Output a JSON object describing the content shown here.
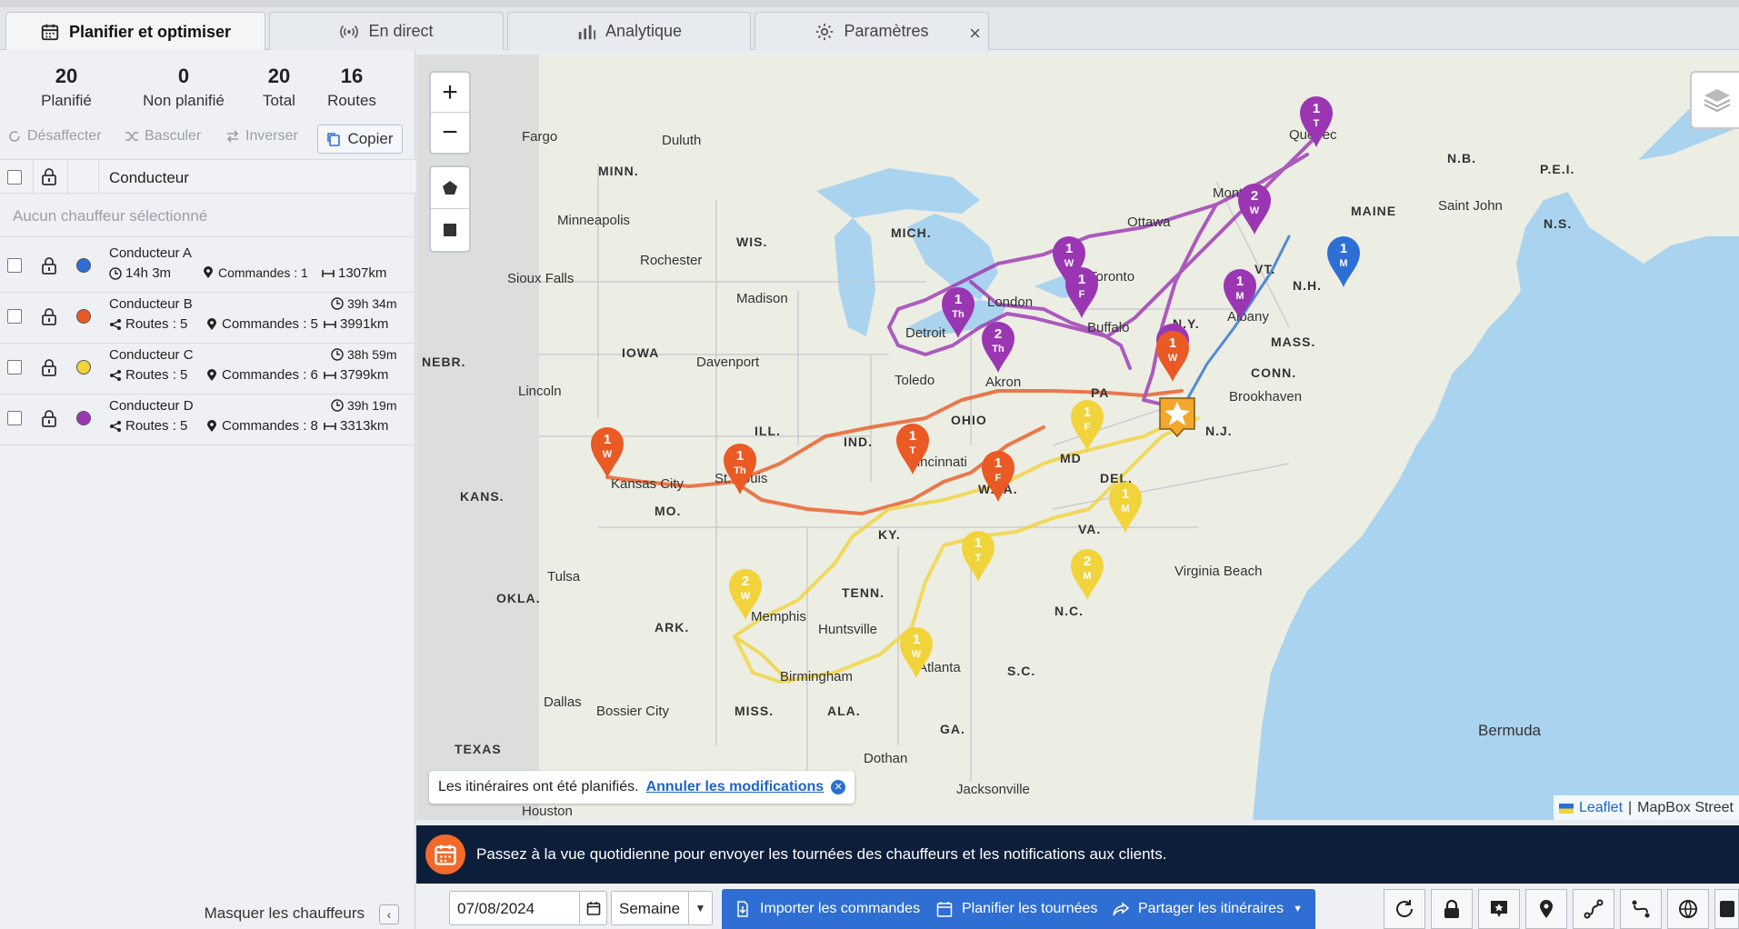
{
  "tabs": [
    {
      "label": "Planifier et optimiser",
      "icon": "calendar-icon"
    },
    {
      "label": "En direct",
      "icon": "broadcast-icon"
    },
    {
      "label": "Analytique",
      "icon": "bar-chart-icon"
    },
    {
      "label": "Paramètres",
      "icon": "gear-icon"
    }
  ],
  "stats": [
    {
      "num": "20",
      "label": "Planifié"
    },
    {
      "num": "0",
      "label": "Non planifié"
    },
    {
      "num": "20",
      "label": "Total"
    },
    {
      "num": "16",
      "label": "Routes"
    }
  ],
  "actions": {
    "unassign": "Désaffecter",
    "toggle": "Basculer",
    "invert": "Inverser",
    "copy": "Copier"
  },
  "table": {
    "header": "Conducteur",
    "empty": "Aucun chauffeur sélectionné"
  },
  "drivers": [
    {
      "name": "Conducteur A",
      "color": "#2e6fd6",
      "time": "14h 3m",
      "orders": "Commandes : 1",
      "distance": "1307km"
    },
    {
      "name": "Conducteur B",
      "color": "#ea5a24",
      "time": "39h 34m",
      "routes": "Routes : 5",
      "orders": "Commandes : 5",
      "distance": "3991km"
    },
    {
      "name": "Conducteur C",
      "color": "#f1d33c",
      "time": "38h 59m",
      "routes": "Routes : 5",
      "orders": "Commandes : 6",
      "distance": "3799km"
    },
    {
      "name": "Conducteur D",
      "color": "#9b36b3",
      "time": "39h 19m",
      "routes": "Routes : 5",
      "orders": "Commandes : 8",
      "distance": "3313km"
    }
  ],
  "hide_drivers": "Masquer les chauffeurs",
  "map": {
    "toast_text": "Les itinéraires ont été planifiés.",
    "toast_link": "Annuler les modifications",
    "attribution_leaflet": "Leaflet",
    "attribution_tiles": "MapBox Street",
    "labels": {
      "fargo": "Fargo",
      "duluth": "Duluth",
      "minn": "MINN.",
      "minneapolis": "Minneapolis",
      "wis": "WIS.",
      "mich": "MICH.",
      "rochester": "Rochester",
      "siouxfalls": "Sioux Falls",
      "madison": "Madison",
      "iowa": "IOWA",
      "davenport": "Davenport",
      "nebr": "NEBR.",
      "lincoln": "Lincoln",
      "ill": "ILL.",
      "ind": "IND.",
      "ohio": "OHIO",
      "kans": "KANS.",
      "kansascity": "Kansas City",
      "stlouis": "St. Louis",
      "mo": "MO.",
      "cincinnati": "Cincinnati",
      "ky": "KY.",
      "wva": "W.VA.",
      "tenn": "TENN.",
      "tulsa": "Tulsa",
      "okla": "OKLA.",
      "ark": "ARK.",
      "memphis": "Memphis",
      "huntsville": "Huntsville",
      "birmingham": "Birmingham",
      "atlanta": "Atlanta",
      "sc": "S.C.",
      "nc": "N.C.",
      "va": "VA.",
      "md": "MD",
      "del": "DEL.",
      "nj": "N.J.",
      "pa": "PA",
      "ny": "N.Y.",
      "toledo": "Toledo",
      "akron": "Akron",
      "detroit": "Detroit",
      "london": "London",
      "toronto": "Toronto",
      "buffalo": "Buffalo",
      "ottawa": "Ottawa",
      "montreal": "Montréal",
      "quebec": "Québec",
      "maine": "MAINE",
      "vt": "VT.",
      "nh": "N.H.",
      "albany": "Albany",
      "mass": "MASS.",
      "conn": "CONN.",
      "brookhaven": "Brookhaven",
      "nb": "N.B.",
      "pei": "P.E.I.",
      "saintjohn": "Saint John",
      "ns": "N.S.",
      "virginiabeach": "Virginia Beach",
      "dallas": "Dallas",
      "bossiercity": "Bossier City",
      "miss": "MISS.",
      "ala": "ALA.",
      "ga": "GA.",
      "dothan": "Dothan",
      "jacksonville": "Jacksonville",
      "texas": "TEXAS",
      "houston": "Houston",
      "bermuda": "Bermuda"
    },
    "pins": [
      {
        "n": "1",
        "d": "T"
      },
      {
        "n": "2",
        "d": "W"
      },
      {
        "n": "1",
        "d": "M"
      },
      {
        "n": "1",
        "d": "M"
      },
      {
        "n": "1",
        "d": "W"
      },
      {
        "n": "1",
        "d": "F"
      },
      {
        "n": "1",
        "d": "Th"
      },
      {
        "n": "2",
        "d": "Th"
      },
      {
        "n": "1",
        "d": "W"
      },
      {
        "n": "1",
        "d": "W"
      },
      {
        "n": "1",
        "d": "Th"
      },
      {
        "n": "1",
        "d": "T"
      },
      {
        "n": "1",
        "d": "F"
      },
      {
        "n": "1",
        "d": "F"
      },
      {
        "n": "1",
        "d": "M"
      },
      {
        "n": "1",
        "d": "T"
      },
      {
        "n": "2",
        "d": "M"
      },
      {
        "n": "2",
        "d": "W"
      },
      {
        "n": "1",
        "d": "W"
      }
    ]
  },
  "banner": "Passez à la vue quotidienne pour envoyer les tournées des chauffeurs et les notifications aux clients.",
  "toolbar": {
    "date": "07/08/2024",
    "period": "Semaine",
    "import": "Importer les commandes",
    "plan": "Planifier les tournées",
    "share": "Partager les itinéraires"
  }
}
